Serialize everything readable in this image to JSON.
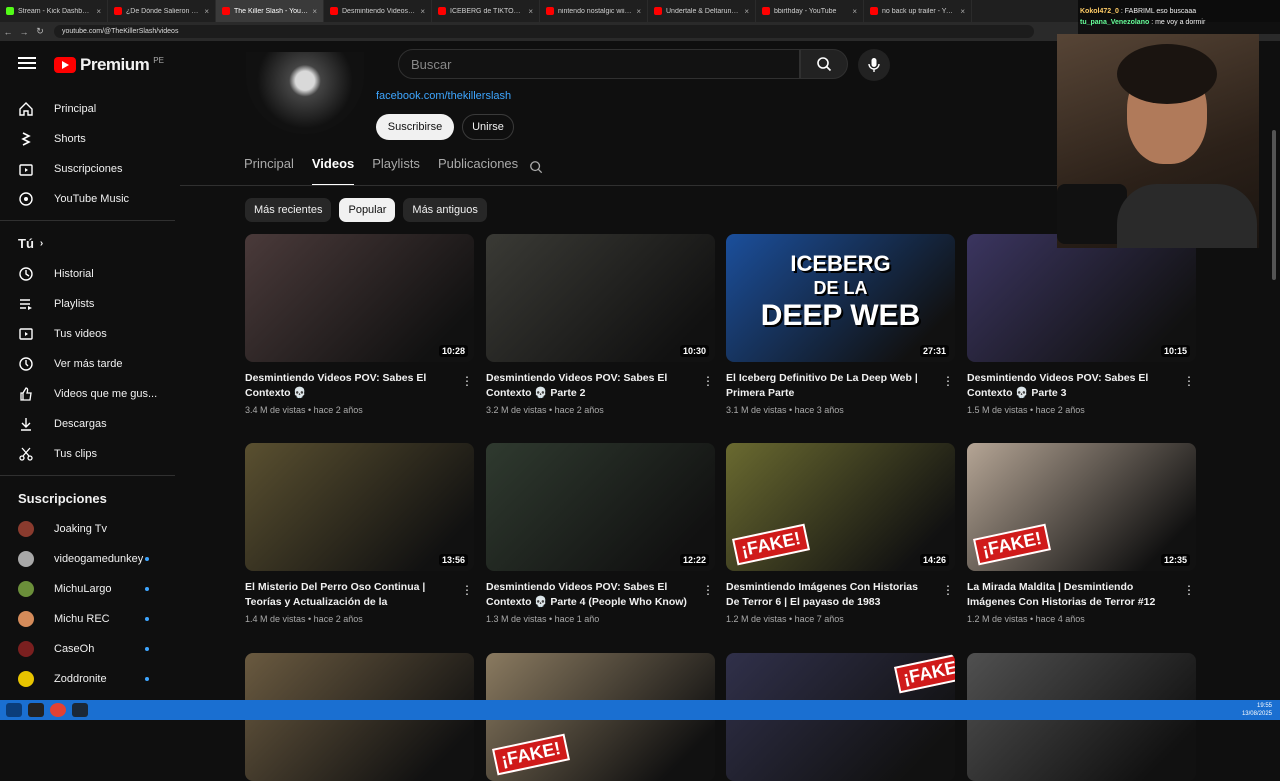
{
  "browser": {
    "tabs": [
      {
        "label": "Stream - Kick Dashboard",
        "color": "#53fc18"
      },
      {
        "label": "¿De Dónde Salieron Estas Foto",
        "color": "#ff0000"
      },
      {
        "label": "The Killer Slash - YouTube",
        "color": "#ff0000",
        "active": true
      },
      {
        "label": "Desmintiendo Videos POV: Sab",
        "color": "#ff0000"
      },
      {
        "label": "ICEBERG de TIKTOK (Polémica",
        "color": "#ff0000"
      },
      {
        "label": "nintendo nostalgic wii mus",
        "color": "#ff0000"
      },
      {
        "label": "Undertale & Deltarune mu",
        "color": "#ff0000"
      },
      {
        "label": "bbirthday - YouTube",
        "color": "#ff0000"
      },
      {
        "label": "no back up trailer - YouTube",
        "color": "#ff0000"
      }
    ],
    "url": "youtube.com/@TheKillerSlash/videos"
  },
  "header": {
    "logo_text": "Premium",
    "logo_region": "PE",
    "search_placeholder": "Buscar"
  },
  "sidebar": {
    "main": [
      {
        "label": "Principal",
        "icon": "home-icon"
      },
      {
        "label": "Shorts",
        "icon": "shorts-icon"
      },
      {
        "label": "Suscripciones",
        "icon": "subscriptions-icon"
      },
      {
        "label": "YouTube Music",
        "icon": "music-icon"
      }
    ],
    "you_heading": "Tú",
    "you": [
      {
        "label": "Historial",
        "icon": "history-icon"
      },
      {
        "label": "Playlists",
        "icon": "playlist-icon"
      },
      {
        "label": "Tus videos",
        "icon": "video-icon"
      },
      {
        "label": "Ver más tarde",
        "icon": "clock-icon"
      },
      {
        "label": "Videos que me gus...",
        "icon": "like-icon"
      },
      {
        "label": "Descargas",
        "icon": "download-icon"
      },
      {
        "label": "Tus clips",
        "icon": "scissors-icon"
      }
    ],
    "subs_heading": "Suscripciones",
    "subs": [
      {
        "label": "Joaking Tv",
        "color": "#8a3b2e",
        "dot": false
      },
      {
        "label": "videogamedunkey",
        "color": "#a8a8a8",
        "dot": true
      },
      {
        "label": "MichuLargo",
        "color": "#6b8f3a",
        "dot": true
      },
      {
        "label": "Michu REC",
        "color": "#d48b5a",
        "dot": true
      },
      {
        "label": "CaseOh",
        "color": "#7a1f1f",
        "dot": true
      },
      {
        "label": "Zoddronite",
        "color": "#e8c400",
        "dot": true
      }
    ]
  },
  "channel": {
    "link": "facebook.com/thekillerslash",
    "subscribe_label": "Suscribirse",
    "join_label": "Unirse",
    "tabs": [
      "Principal",
      "Videos",
      "Playlists",
      "Publicaciones"
    ],
    "active_tab": "Videos"
  },
  "chips": [
    "Más recientes",
    "Popular",
    "Más antiguos"
  ],
  "active_chip": "Popular",
  "videos": [
    {
      "title": "Desmintiendo Videos POV: Sabes El Contexto 💀",
      "meta": "3.4 M de vistas • hace 2 años",
      "duration": "10:28",
      "bg": "#4a3a3a"
    },
    {
      "title": "Desmintiendo Videos POV: Sabes El Contexto 💀 Parte 2",
      "meta": "3.2 M de vistas • hace 2 años",
      "duration": "10:30",
      "bg": "#3a3a35"
    },
    {
      "title": "El Iceberg Definitivo De La Deep Web | Primera Parte",
      "meta": "3.1 M de vistas • hace 3 años",
      "duration": "27:31",
      "bg": "#1b4f9c"
    },
    {
      "title": "Desmintiendo Videos POV: Sabes El Contexto 💀 Parte 3",
      "meta": "1.5 M de vistas • hace 2 años",
      "duration": "10:15",
      "bg": "#3b3560"
    },
    {
      "title": "El Misterio Del Perro Oso Continua | Teorías y Actualización de la investigación",
      "meta": "1.4 M de vistas • hace 2 años",
      "duration": "13:56",
      "bg": "#5a5030"
    },
    {
      "title": "Desmintiendo Videos POV: Sabes El Contexto 💀 Parte 4 (People Who Know)",
      "meta": "1.3 M de vistas • hace 1 año",
      "duration": "12:22",
      "bg": "#2f3a2f"
    },
    {
      "title": "Desmintiendo Imágenes Con Historias De Terror 6 | El payaso de 1983",
      "meta": "1.2 M de vistas • hace 7 años",
      "duration": "14:26",
      "bg": "#6a6a30"
    },
    {
      "title": "La Mirada Maldita | Desmintiendo Imágenes Con Historias de Terror #12",
      "meta": "1.2 M de vistas • hace 4 años",
      "duration": "12:35",
      "bg": "#b5a595"
    },
    {
      "title": "",
      "meta": "",
      "duration": "",
      "bg": "#6a5a40"
    },
    {
      "title": "",
      "meta": "",
      "duration": "",
      "bg": "#8a7a60"
    },
    {
      "title": "",
      "meta": "",
      "duration": "",
      "bg": "#30304a"
    },
    {
      "title": "",
      "meta": "",
      "duration": "",
      "bg": "#505050"
    }
  ],
  "fake_label": "¡FAKE!",
  "iceberg_text": [
    "ICEBERG",
    "DE LA",
    "DEEP WEB"
  ],
  "stream_chat": [
    {
      "user": "Kokol472_0",
      "text": "FABRIML eso buscaaa",
      "color": "#ffcc66"
    },
    {
      "user": "tu_pana_Venezolano",
      "text": "me voy a dormir",
      "color": "#66ff99"
    }
  ],
  "tray": {
    "time": "19:55",
    "date": "13/08/2025"
  }
}
